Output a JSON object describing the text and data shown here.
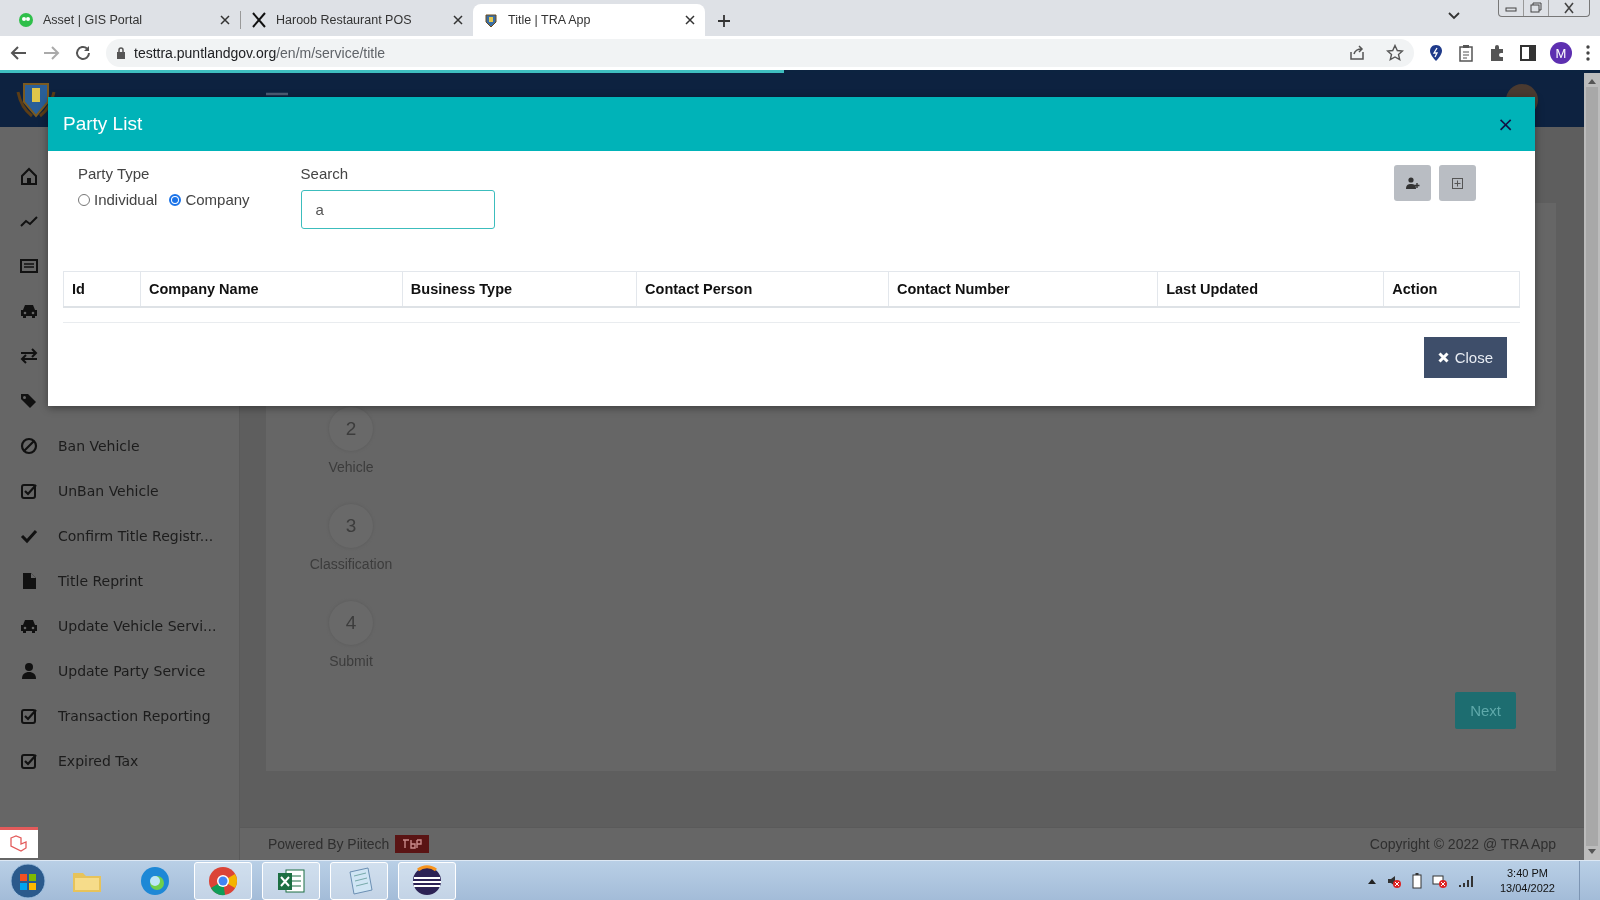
{
  "browser": {
    "tabs": [
      {
        "title": "Asset | GIS Portal",
        "selected": false
      },
      {
        "title": "Haroob Restaurant POS",
        "selected": false
      },
      {
        "title": "Title | TRA App",
        "selected": true
      }
    ],
    "url_host": "testtra.puntlandgov.org",
    "url_path": "/en/m/service/title",
    "profile_initial": "M",
    "page_loading": {
      "level": 0.49
    }
  },
  "sidebar": {
    "items": [
      {
        "label": "Ban Vehicle"
      },
      {
        "label": "UnBan Vehicle"
      },
      {
        "label": "Confirm Title Registr..."
      },
      {
        "label": "Title Reprint"
      },
      {
        "label": "Update Vehicle Servi..."
      },
      {
        "label": "Update Party Service"
      },
      {
        "label": "Transaction Reporting"
      },
      {
        "label": "Expired Tax"
      }
    ]
  },
  "steps": [
    {
      "number": "2",
      "label": "Vehicle"
    },
    {
      "number": "3",
      "label": "Classification"
    },
    {
      "number": "4",
      "label": "Submit"
    }
  ],
  "next_button": "Next",
  "footer": {
    "powered_by": "Powered By Piitech",
    "copyright": "Copyright © 2022 @ TRA App"
  },
  "modal": {
    "title": "Party List",
    "close_icon": "×",
    "party_type": {
      "label": "Party Type",
      "options": [
        {
          "label": "Individual",
          "selected": false
        },
        {
          "label": "Company",
          "selected": true
        }
      ]
    },
    "search": {
      "label": "Search",
      "value": "a"
    },
    "table": {
      "columns": [
        "Id",
        "Company Name",
        "Business Type",
        "Contact Person",
        "Contact Number",
        "Last Updated",
        "Action"
      ]
    },
    "close_button": "Close"
  },
  "taskbar": {
    "time": "3:40 PM",
    "date": "13/04/2022"
  }
}
